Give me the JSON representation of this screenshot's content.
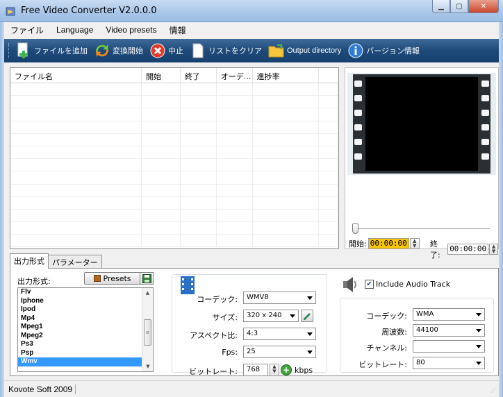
{
  "window": {
    "title": "Free Video Converter V2.0.0.0"
  },
  "menu": [
    "ファイル",
    "Language",
    "Video presets",
    "情報"
  ],
  "toolbar": {
    "add_file": "ファイルを追加",
    "start": "変換開始",
    "stop": "中止",
    "clear": "リストをクリア",
    "output_dir": "Output directory",
    "version": "バージョン情報"
  },
  "filelist": {
    "columns": [
      "ファイル名",
      "開始",
      "終了",
      "オーデ...",
      "進捗率"
    ]
  },
  "preview": {
    "start_label": "開始:",
    "start_time": "00:00:00",
    "end_label": "終了:",
    "end_time": "00:00:00",
    "slider_position": 0
  },
  "tabs": [
    "出力形式",
    "パラメーター"
  ],
  "format": {
    "label": "出力形式:",
    "presets_label": "Presets",
    "items": [
      "Flv",
      "Iphone",
      "Ipod",
      "Mp4",
      "Mpeg1",
      "Mpeg2",
      "Ps3",
      "Psp",
      "Wmv"
    ],
    "selected": "Wmv"
  },
  "video": {
    "codec_label": "コーデック:",
    "codec": "WMV8",
    "size_label": "サイズ:",
    "size": "320 x 240",
    "aspect_label": "アスペクト比:",
    "aspect": "4:3",
    "fps_label": "Fps:",
    "fps": "25",
    "bitrate_label": "ビットレート:",
    "bitrate": "768",
    "bitrate_unit": "kbps"
  },
  "audio": {
    "include_label": "Include Audio Track",
    "include_checked": true,
    "codec_label": "コーデック:",
    "codec": "WMA",
    "freq_label": "周波数:",
    "freq": "44100",
    "channel_label": "チャンネル:",
    "channel": "",
    "bitrate_label": "ビットレート:",
    "bitrate": "80"
  },
  "status": {
    "text": "Kovote Soft 2009"
  },
  "colors": {
    "toolbar": "#1e4a7a",
    "selection": "#3399ff",
    "time_highlight": "#f7c400"
  }
}
